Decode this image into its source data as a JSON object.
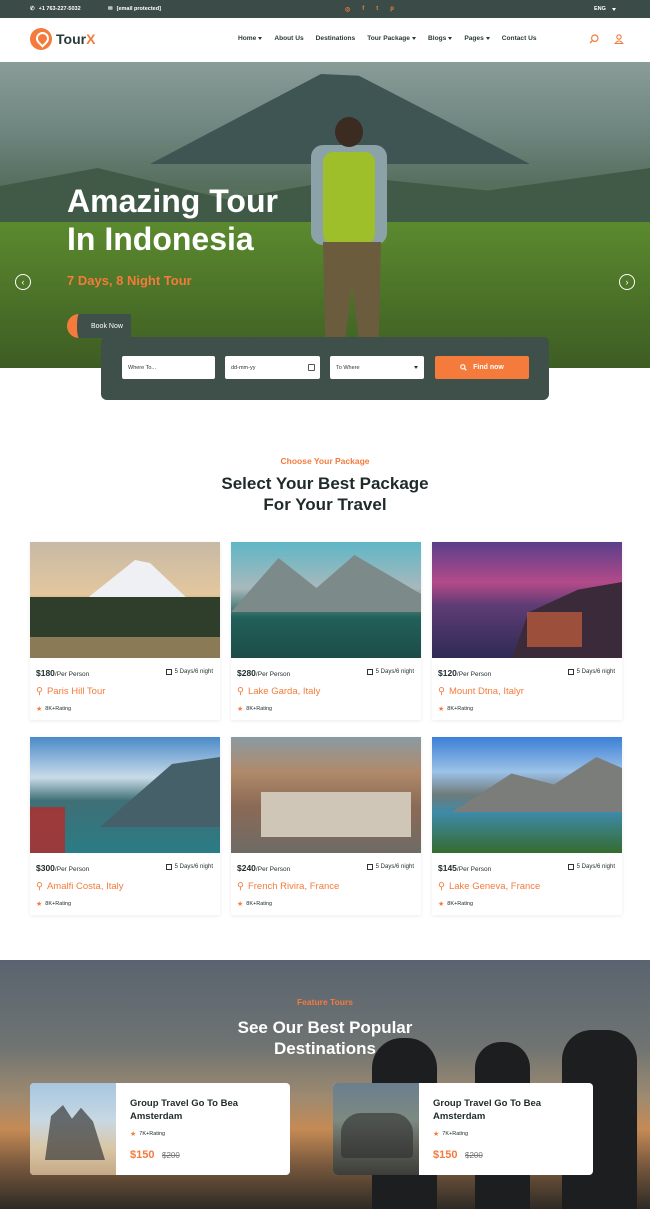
{
  "topbar": {
    "phone": "+1 763-227-5032",
    "email": "[email protected]",
    "language": "ENG",
    "social_icons": [
      "instagram-icon",
      "facebook-icon",
      "twitter-icon",
      "pinterest-icon"
    ]
  },
  "logo": {
    "text_a": "Tour",
    "text_b": "X"
  },
  "menu": [
    {
      "label": "Home",
      "dropdown": true
    },
    {
      "label": "About Us",
      "dropdown": false
    },
    {
      "label": "Destinations",
      "dropdown": false
    },
    {
      "label": "Tour Package",
      "dropdown": true
    },
    {
      "label": "Blogs",
      "dropdown": true
    },
    {
      "label": "Pages",
      "dropdown": true
    },
    {
      "label": "Contact Us",
      "dropdown": false
    }
  ],
  "hero": {
    "title_line1": "Amazing Tour",
    "title_line2": "In Indonesia",
    "subtitle": "7 Days, 8 Night Tour",
    "cta": "Book Now"
  },
  "search": {
    "where_placeholder": "Where To...",
    "date_placeholder": "dd-mm-yy",
    "to_select": "To Where",
    "button": "Find now"
  },
  "packages": {
    "kicker": "Choose Your Package",
    "title_line1": "Select Your Best Package",
    "title_line2": "For Your Travel",
    "items": [
      {
        "price": "$180",
        "per": "/Per Person",
        "duration": "5 Days/6 night",
        "name": "Paris Hill Tour",
        "rating": "8K+Rating"
      },
      {
        "price": "$280",
        "per": "/Per Person",
        "duration": "5 Days/6 night",
        "name": "Lake Garda, Italy",
        "rating": "8K+Rating"
      },
      {
        "price": "$120",
        "per": "/Per Person",
        "duration": "5 Days/6 night",
        "name": "Mount Dtna, Italyr",
        "rating": "8K+Rating"
      },
      {
        "price": "$300",
        "per": "/Per Person",
        "duration": "5 Days/6 night",
        "name": "Amalfi Costa, Italy",
        "rating": "8K+Rating"
      },
      {
        "price": "$240",
        "per": "/Per Person",
        "duration": "5 Days/6 night",
        "name": "French Rivira, France",
        "rating": "8K+Rating"
      },
      {
        "price": "$145",
        "per": "/Per Person",
        "duration": "5 Days/6 night",
        "name": "Lake Geneva, France",
        "rating": "8K+Rating"
      }
    ]
  },
  "featured": {
    "kicker": "Feature Tours",
    "title_line1": "See Our Best Popular",
    "title_line2": "Destinations",
    "items": [
      {
        "title_line1": "Group Travel Go To Bea",
        "title_line2": "Amsterdam",
        "rating": "7K+Rating",
        "price": "$150",
        "old_price": "$200"
      },
      {
        "title_line1": "Group Travel Go To Bea",
        "title_line2": "Amsterdam",
        "rating": "7K+Rating",
        "price": "$150",
        "old_price": "$200"
      }
    ]
  },
  "colors": {
    "accent": "#f47b3c",
    "dark": "#3b4b47",
    "text": "#1f2a2a"
  }
}
